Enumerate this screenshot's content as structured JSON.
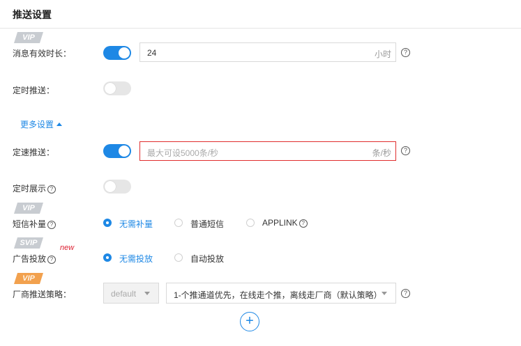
{
  "header": {
    "title": "推送设置"
  },
  "badges": {
    "vip": "VIP",
    "svip": "SVIP",
    "new": "new"
  },
  "colors": {
    "accent": "#1e88e5",
    "error": "#e02d2d",
    "toggle_off": "#e6e6e6",
    "vip_badge": "#c8ccd1",
    "vip_orange": "#f2a14e"
  },
  "expiry": {
    "label": "消息有效时长：",
    "enabled": true,
    "value": "24",
    "unit": "小时",
    "help_icon": "question-circle-icon"
  },
  "scheduled_push": {
    "label": "定时推送：",
    "enabled": false
  },
  "more_settings": {
    "label": "更多设置",
    "icon": "caret-up-icon"
  },
  "rate_limit": {
    "label": "定速推送：",
    "enabled": true,
    "placeholder": "最大可设5000条/秒",
    "unit": "条/秒"
  },
  "scheduled_display": {
    "label": "定时展示",
    "enabled": false
  },
  "sms": {
    "label": "短信补量",
    "options": [
      "无需补量",
      "普通短信",
      "APPLINK"
    ],
    "selected": "无需补量"
  },
  "ads": {
    "label": "广告投放",
    "options": [
      "无需投放",
      "自动投放"
    ],
    "selected": "无需投放"
  },
  "vendor": {
    "label": "厂商推送策略：",
    "mode_value": "default",
    "strategy_value": "1-个推通道优先，在线走个推，离线走厂商（默认策略）"
  },
  "add": {
    "symbol": "+"
  }
}
